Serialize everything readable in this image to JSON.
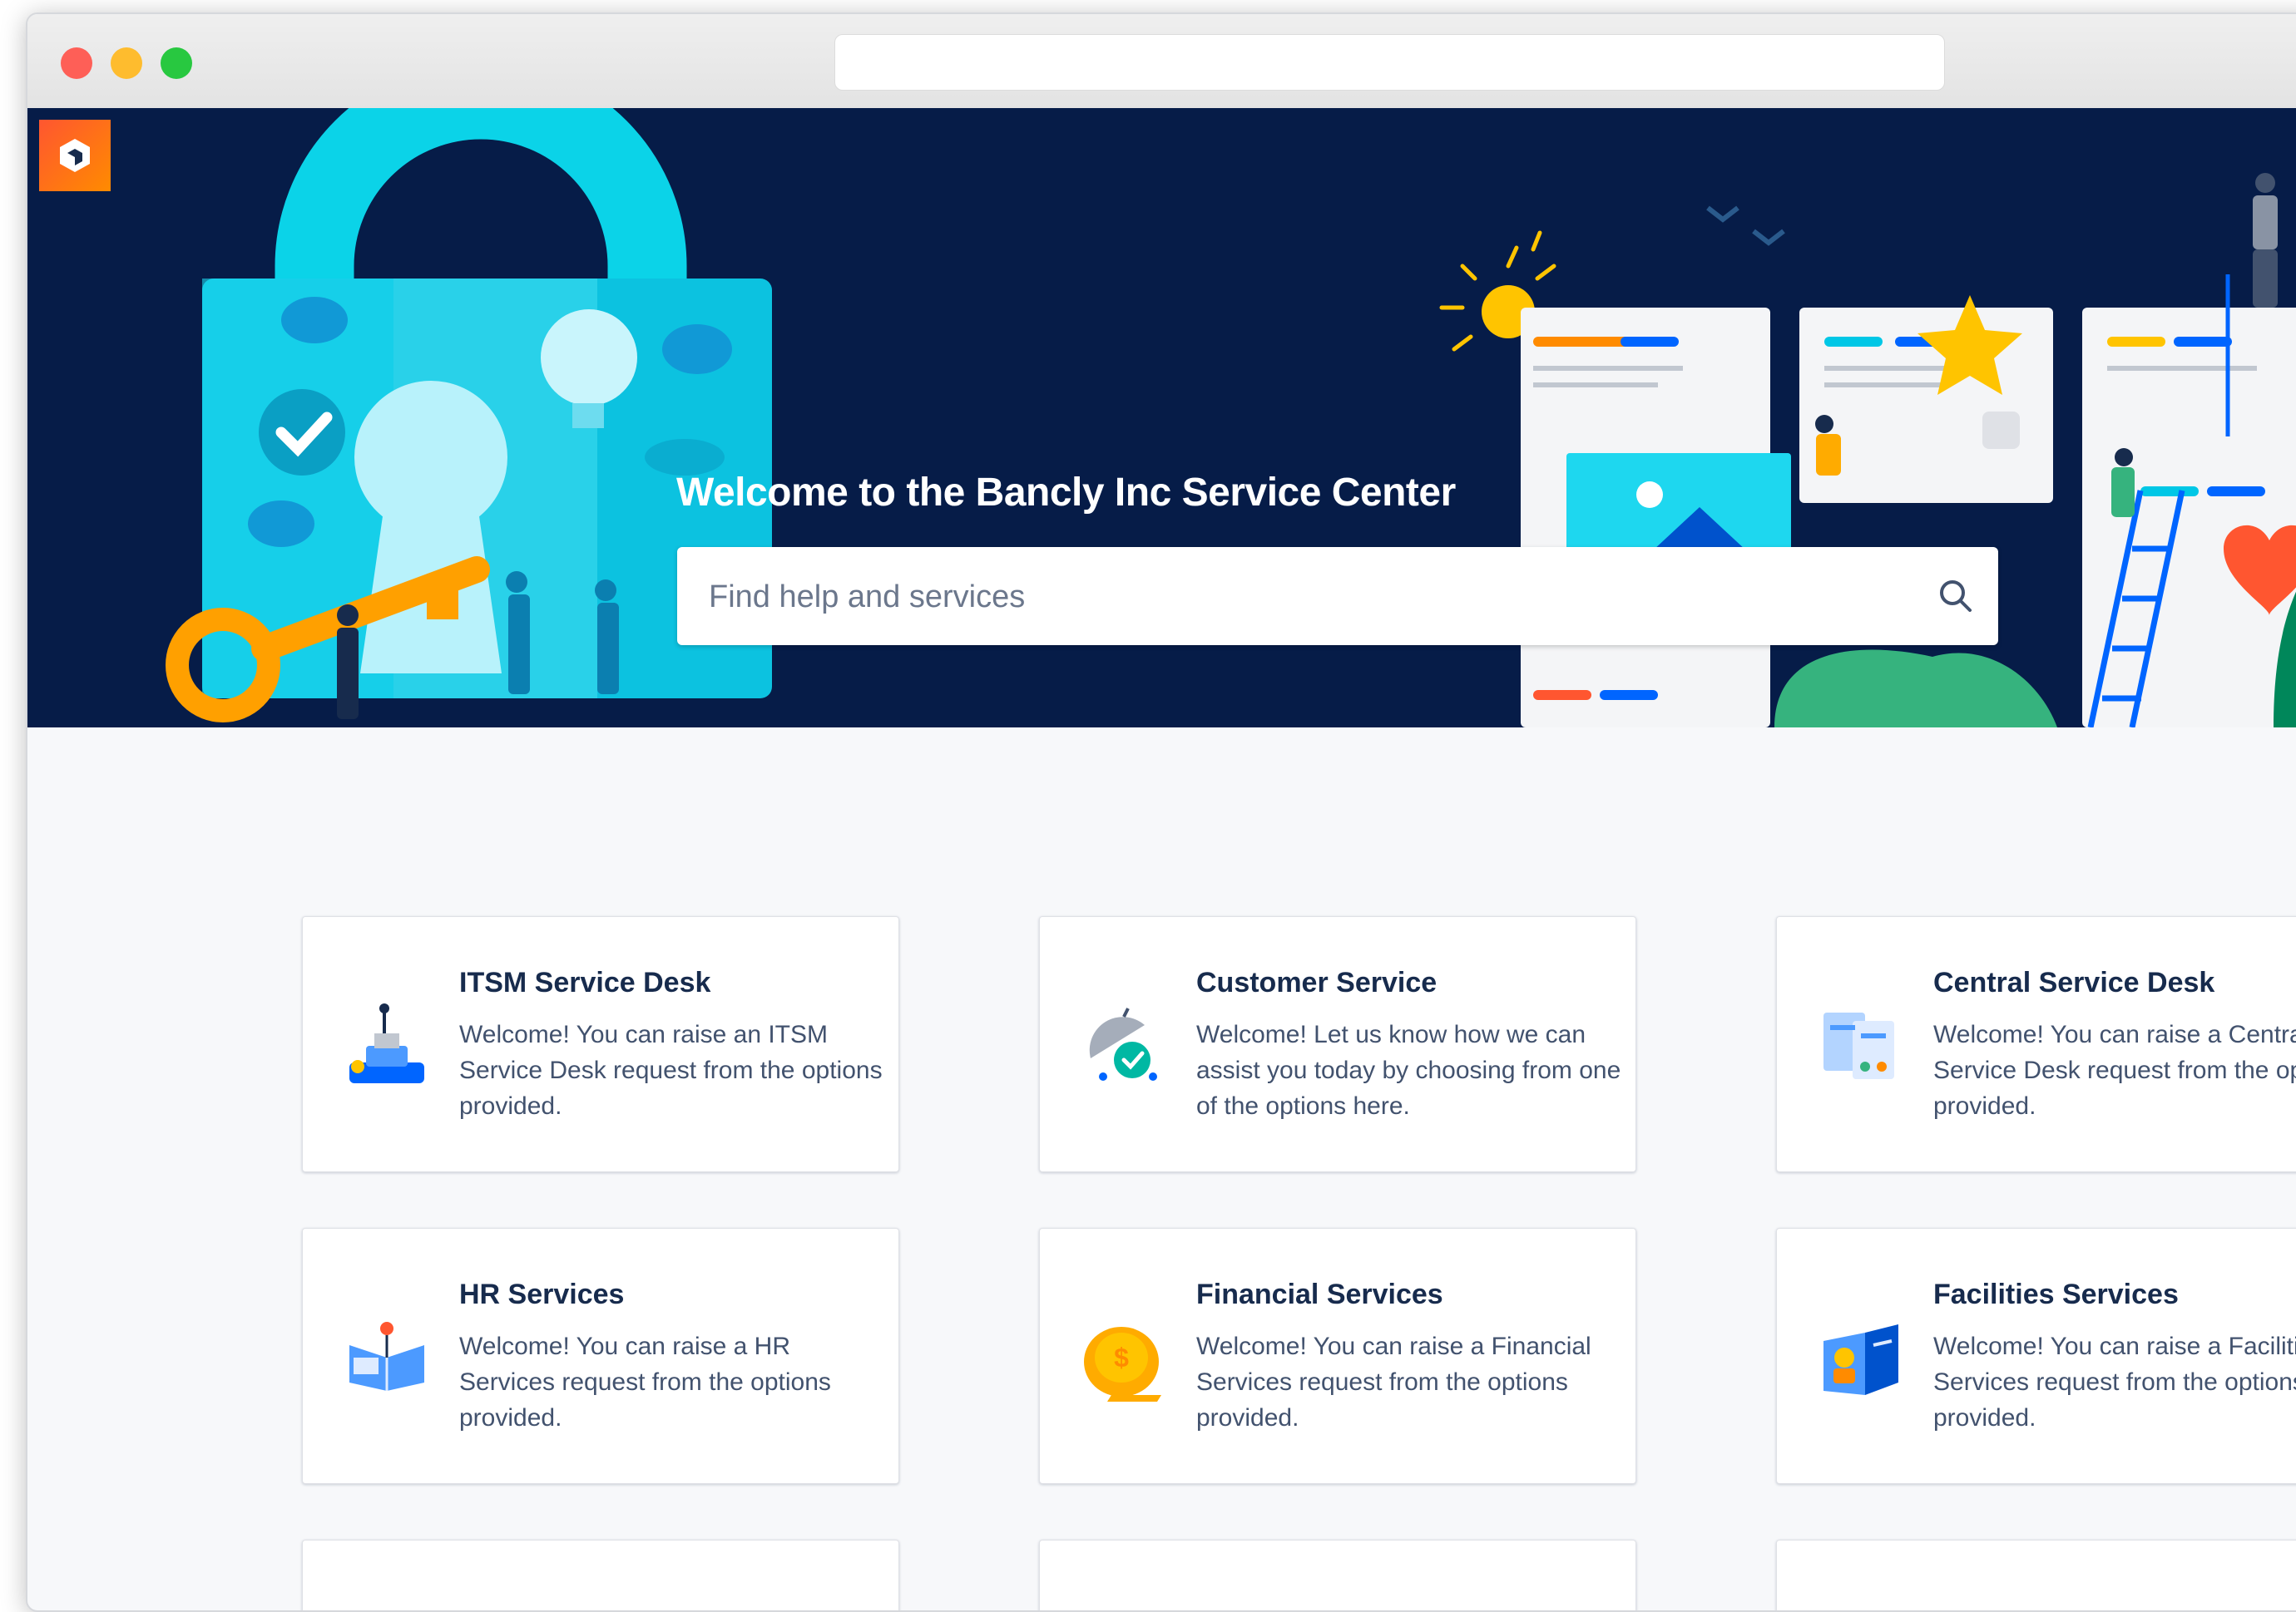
{
  "hero": {
    "title": "Welcome to the Bancly Inc Service Center",
    "search_placeholder": "Find help and services",
    "background_color": "#061c48"
  },
  "services": [
    {
      "title": "ITSM Service Desk",
      "description": "Welcome! You can raise an ITSM Service Desk request from the options provided.",
      "icon": "itsm-icon"
    },
    {
      "title": "Customer Service",
      "description": "Welcome! Let us know how we can assist you today by choosing from one of the options here.",
      "icon": "customer-service-icon"
    },
    {
      "title": "Central Service Desk",
      "description": "Welcome! You can raise a Central Service Desk request from the options provided.",
      "icon": "central-service-desk-icon"
    },
    {
      "title": "HR Services",
      "description": "Welcome! You can raise a HR Services request from the options provided.",
      "icon": "hr-services-icon"
    },
    {
      "title": "Financial Services",
      "description": "Welcome! You can raise a Financial Services request from the options provided.",
      "icon": "financial-services-icon"
    },
    {
      "title": "Facilities Services",
      "description": "Welcome! You can raise a Facilities Services request from the options provided.",
      "icon": "facilities-services-icon"
    }
  ],
  "colors": {
    "accent": "#0052cc",
    "title_text": "#172b4d",
    "body_text": "#42526e",
    "logo_gradient_start": "#ff5630",
    "logo_gradient_end": "#ff8b00"
  }
}
